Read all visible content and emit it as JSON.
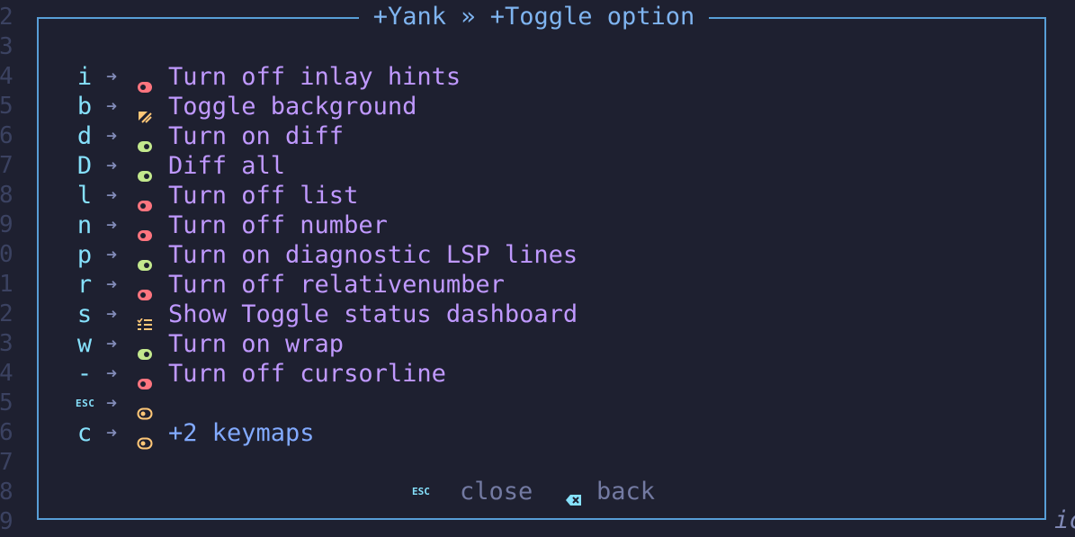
{
  "gutter": {
    "line_numbers": [
      "2",
      "3",
      "4",
      "5",
      "6",
      "7",
      "8",
      "9",
      "0",
      "1",
      "2",
      "3",
      "4",
      "5",
      "6",
      "7",
      "8",
      "9"
    ]
  },
  "trailing_text": "ic",
  "panel": {
    "title": "+Yank » +Toggle option",
    "border_color": "#589ed7",
    "items": [
      {
        "key": "i",
        "icon": "toggle-off-icon",
        "icon_color": "#ff757f",
        "label": "Turn off inlay hints"
      },
      {
        "key": "b",
        "icon": "background-icon",
        "icon_color": "#ffc777",
        "label": "Toggle background"
      },
      {
        "key": "d",
        "icon": "toggle-on-icon",
        "icon_color": "#c3e88d",
        "label": "Turn on diff"
      },
      {
        "key": "D",
        "icon": "toggle-on-icon",
        "icon_color": "#c3e88d",
        "label": "Diff all"
      },
      {
        "key": "l",
        "icon": "toggle-off-icon",
        "icon_color": "#ff757f",
        "label": "Turn off list"
      },
      {
        "key": "n",
        "icon": "toggle-off-icon",
        "icon_color": "#ff757f",
        "label": "Turn off number"
      },
      {
        "key": "p",
        "icon": "toggle-on-icon",
        "icon_color": "#c3e88d",
        "label": "Turn on diagnostic LSP lines"
      },
      {
        "key": "r",
        "icon": "toggle-off-icon",
        "icon_color": "#ff757f",
        "label": "Turn off relativenumber"
      },
      {
        "key": "s",
        "icon": "checklist-icon",
        "icon_color": "#ffc777",
        "label": "Show Toggle status dashboard"
      },
      {
        "key": "w",
        "icon": "toggle-on-icon",
        "icon_color": "#c3e88d",
        "label": "Turn on wrap"
      },
      {
        "key": "-",
        "icon": "toggle-off-icon",
        "icon_color": "#ff757f",
        "label": "Turn off cursorline"
      },
      {
        "key": "ESC",
        "icon": "toggle-icon",
        "icon_color": "#ffc777",
        "label": ""
      },
      {
        "key": "c",
        "icon": "toggle-icon",
        "icon_color": "#ffc777",
        "label": "+2 keymaps",
        "group": true
      }
    ]
  },
  "footer": {
    "close_key": "ESC",
    "close_label": "close",
    "back_icon": "backspace-icon",
    "back_label": "back"
  },
  "colors": {
    "background": "#1e2030",
    "key": "#86e1fc",
    "arrow": "#828bb8",
    "description": "#c099ff",
    "group": "#82aaff",
    "footer_text": "#737aa2",
    "line_number": "#3b4261"
  }
}
